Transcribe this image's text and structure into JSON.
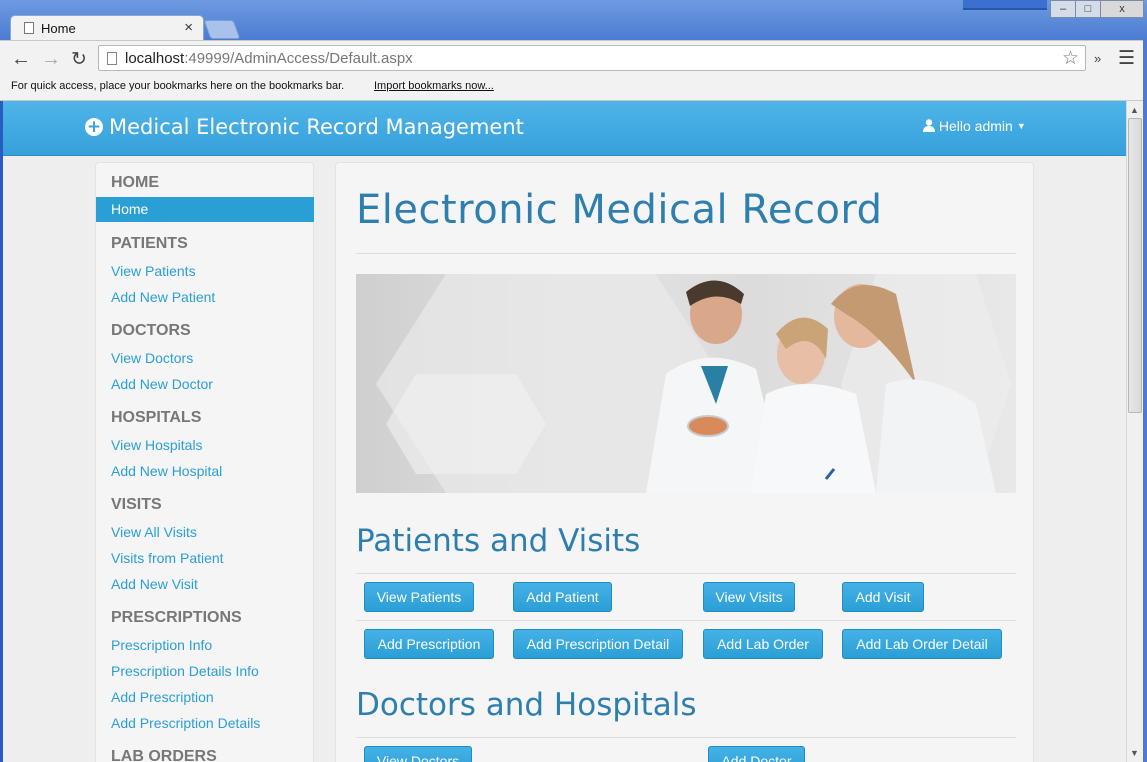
{
  "browser": {
    "tab_title": "Home",
    "tab_close": "×",
    "url_host": "localhost",
    "url_path": ":49999/AdminAccess/Default.aspx",
    "bookmarks_message": "For quick access, place your bookmarks here on the bookmarks bar.",
    "bookmarks_link": "Import bookmarks now...",
    "window_controls": [
      "–",
      "□",
      "x"
    ]
  },
  "navbar": {
    "brand": "Medical Electronic Record Management",
    "user": "Hello admin"
  },
  "sidebar": {
    "sections": [
      {
        "heading": "HOME",
        "items": [
          "Home"
        ]
      },
      {
        "heading": "PATIENTS",
        "items": [
          "View Patients",
          "Add New Patient"
        ]
      },
      {
        "heading": "DOCTORS",
        "items": [
          "View Doctors",
          "Add New Doctor"
        ]
      },
      {
        "heading": "HOSPITALS",
        "items": [
          "View Hospitals",
          "Add New Hospital"
        ]
      },
      {
        "heading": "VISITS",
        "items": [
          "View All Visits",
          "Visits from Patient",
          "Add New Visit"
        ]
      },
      {
        "heading": "PRESCRIPTIONS",
        "items": [
          "Prescription Info",
          "Prescription Details Info",
          "Add Prescription",
          "Add Prescription Details"
        ]
      },
      {
        "heading": "LAB ORDERS",
        "items": []
      }
    ],
    "active_item": "Home"
  },
  "main": {
    "title": "Electronic Medical Record",
    "patients_visits": {
      "heading": "Patients and Visits",
      "row1": [
        "View Patients",
        "Add Patient",
        "View Visits",
        "Add Visit"
      ],
      "row2": [
        "Add Prescription",
        "Add Prescription Detail",
        "Add Lab Order",
        "Add Lab Order Detail"
      ]
    },
    "doctors_hospitals": {
      "heading": "Doctors and Hospitals",
      "row1": [
        "View Doctors",
        "Add Doctor"
      ]
    }
  },
  "colors": {
    "accent": "#2a9fd6",
    "heading": "#2f7fae",
    "navbar": "#3aa4df"
  }
}
